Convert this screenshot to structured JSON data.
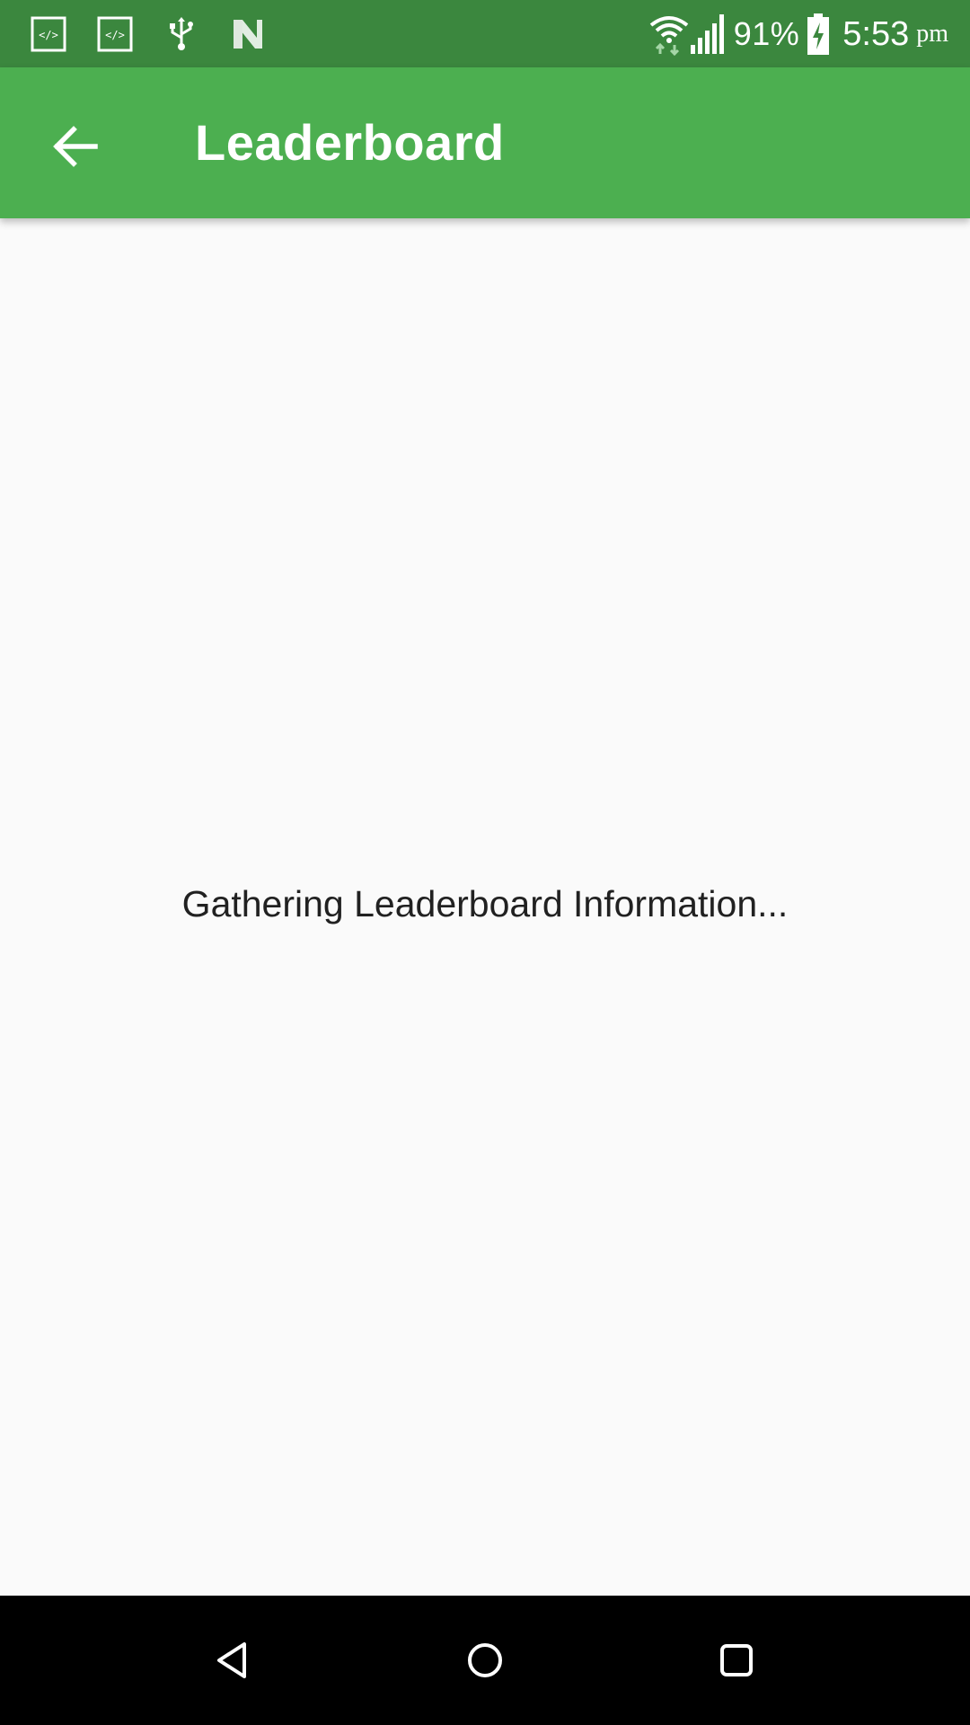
{
  "status_bar": {
    "icons_left": [
      "code-icon",
      "code-icon",
      "usb-icon",
      "n-notification-icon"
    ],
    "icons_right": [
      "wifi-icon",
      "signal-icon",
      "battery-charging-icon"
    ],
    "battery_percent": "91%",
    "time": "5:53",
    "time_suffix": "pm",
    "background_color": "#3b873e"
  },
  "app_bar": {
    "back_icon": "arrow-left-icon",
    "title": "Leaderboard",
    "background_color": "#4caf50"
  },
  "content": {
    "loading_message": "Gathering Leaderboard Information...",
    "background_color": "#fafafa"
  },
  "nav_bar": {
    "buttons": [
      "nav-back-icon",
      "nav-home-icon",
      "nav-recents-icon"
    ],
    "background_color": "#000000"
  }
}
